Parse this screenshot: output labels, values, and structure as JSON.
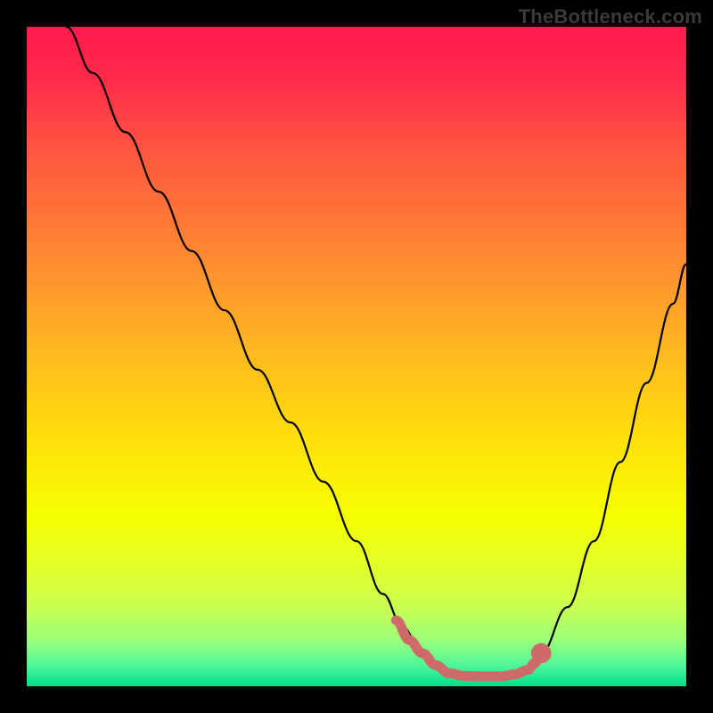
{
  "watermark": "TheBottleneck.com",
  "chart_data": {
    "type": "line",
    "title": "",
    "xlabel": "",
    "ylabel": "",
    "xlim": [
      0,
      100
    ],
    "ylim": [
      0,
      100
    ],
    "series": [
      {
        "name": "curve",
        "color": "#000000",
        "x": [
          6,
          10,
          15,
          20,
          25,
          30,
          35,
          40,
          45,
          50,
          54,
          57,
          60,
          64,
          68,
          72,
          76,
          78,
          82,
          86,
          90,
          94,
          98,
          100
        ],
        "y": [
          100,
          93,
          84,
          75,
          66,
          57,
          48,
          40,
          31,
          22,
          14,
          9,
          5,
          2,
          1.5,
          1.5,
          2.5,
          5,
          12,
          22,
          34,
          46,
          58,
          64
        ]
      },
      {
        "name": "highlight-segment",
        "color": "#cf6a6a",
        "x": [
          56,
          58,
          60,
          62,
          64,
          66,
          68,
          70,
          72,
          74,
          76,
          77,
          78
        ],
        "y": [
          10,
          7,
          5,
          3.2,
          2,
          1.6,
          1.5,
          1.5,
          1.5,
          1.8,
          2.5,
          3.5,
          5
        ]
      }
    ],
    "marker": {
      "x": 78,
      "y": 5,
      "r": 1.1,
      "color": "#cf6a6a"
    },
    "background_gradient": {
      "stops": [
        {
          "offset": 0.0,
          "color": "#ff1a4d"
        },
        {
          "offset": 0.08,
          "color": "#ff2a4a"
        },
        {
          "offset": 0.2,
          "color": "#ff5a3e"
        },
        {
          "offset": 0.35,
          "color": "#ff8a32"
        },
        {
          "offset": 0.5,
          "color": "#ffbb1e"
        },
        {
          "offset": 0.62,
          "color": "#ffde0c"
        },
        {
          "offset": 0.74,
          "color": "#f6ff00"
        },
        {
          "offset": 0.82,
          "color": "#e2ff2a"
        },
        {
          "offset": 0.88,
          "color": "#c8ff52"
        },
        {
          "offset": 0.93,
          "color": "#9cff7a"
        },
        {
          "offset": 0.97,
          "color": "#4cf59a"
        },
        {
          "offset": 1.0,
          "color": "#00e08a"
        }
      ]
    }
  }
}
